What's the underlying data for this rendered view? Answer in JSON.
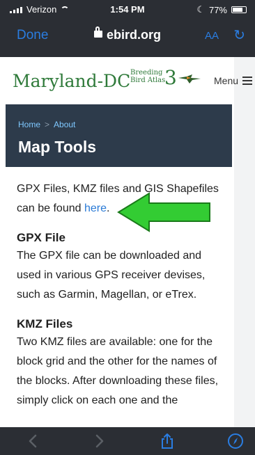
{
  "status": {
    "carrier": "Verizon",
    "time": "1:54 PM",
    "battery": "77%",
    "battery_level": 0.77
  },
  "safari": {
    "done_label": "Done",
    "url": "ebird.org",
    "aa_label": "AA"
  },
  "site": {
    "logo_main": "Maryland-DC",
    "logo_small_1": "Breeding",
    "logo_small_2": "Bird Atlas",
    "logo_number": "3",
    "menu_label": "Menu"
  },
  "banner": {
    "breadcrumb_home": "Home",
    "breadcrumb_sep": ">",
    "breadcrumb_about": "About",
    "title": "Map Tools"
  },
  "content": {
    "intro_text": "GPX Files, KMZ files and GIS Shapefiles can be found",
    "intro_link": "here",
    "intro_end": ".",
    "gpx_heading": "GPX File",
    "gpx_text": "The GPX file can be downloaded and used in various GPS receiver devises, such as Garmin, Magellan, or eTrex.",
    "kmz_heading": "KMZ Files",
    "kmz_text": "Two KMZ files are available: one for the block grid and the other for the names of the blocks. After downloading these files, simply click on each one and the"
  },
  "colors": {
    "chrome": "#2b2e34",
    "accent_blue": "#2a7de1",
    "brand_green": "#2f7a3a",
    "banner": "#2d3b4b",
    "arrow_green": "#33cc33"
  },
  "icons": {
    "back": "chevron-left-icon",
    "forward": "chevron-right-icon",
    "share": "share-icon",
    "compass": "compass-icon"
  }
}
